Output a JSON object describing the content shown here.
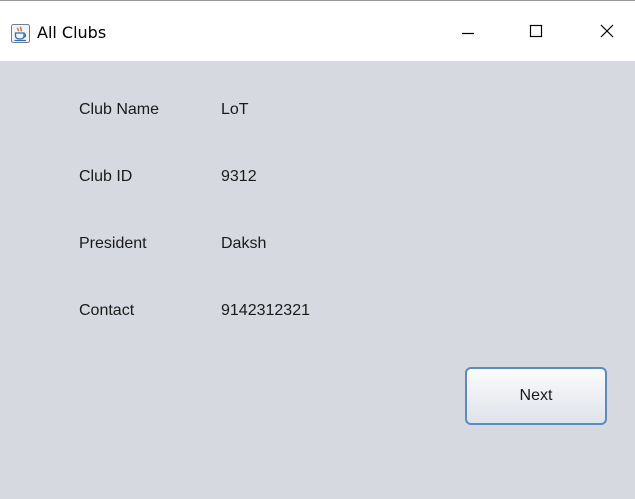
{
  "window": {
    "title": "All Clubs",
    "icon": "java-coffee-icon",
    "controls": {
      "minimize_icon": "minimize-icon",
      "maximize_icon": "maximize-icon",
      "close_icon": "close-icon"
    }
  },
  "fields": [
    {
      "label": "Club Name",
      "value": "LoT"
    },
    {
      "label": "Club ID",
      "value": "9312"
    },
    {
      "label": "President",
      "value": "Daksh"
    },
    {
      "label": "Contact",
      "value": "9142312321"
    }
  ],
  "actions": {
    "next_label": "Next"
  },
  "colors": {
    "background": "#d7d9e0",
    "titlebar": "#ffffff",
    "button_border": "#5b8bc6"
  }
}
